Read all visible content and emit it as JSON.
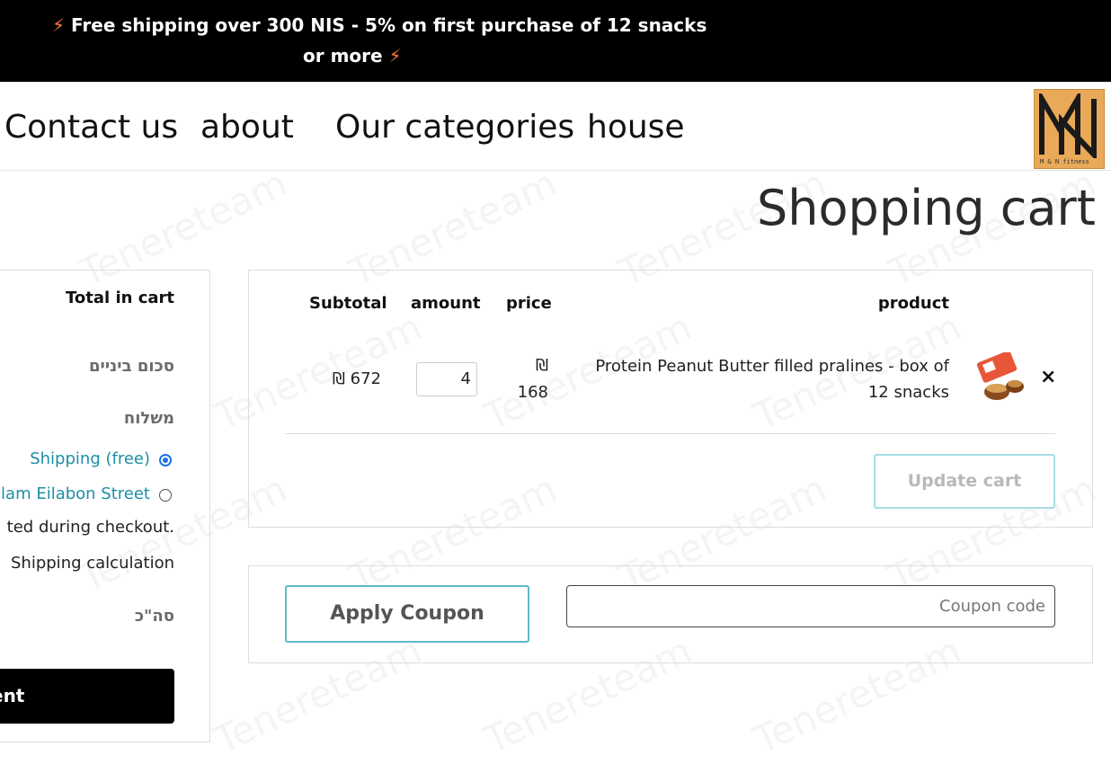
{
  "announcement": {
    "line1": "Free shipping over 300 NIS - 5% on first purchase of 12 snacks",
    "line2": "or more",
    "bolt_left": "⚡",
    "bolt_right": "⚡"
  },
  "nav": {
    "items": [
      "Contact us",
      "about",
      "Our categories",
      "house"
    ]
  },
  "logo": {
    "brand_text": "M & N fitness"
  },
  "page_title": "Shopping cart",
  "cart": {
    "headers": {
      "subtotal": "Subtotal",
      "amount": "amount",
      "price": "price",
      "product": "product"
    },
    "items": [
      {
        "product_line1": "Protein Peanut Butter filled pralines - box of",
        "product_line2": "12 snacks",
        "price_line1": "₪",
        "price_line2": "168",
        "quantity": "4",
        "subtotal": "₪ 672",
        "remove_glyph": "×"
      }
    ],
    "update_button": "Update cart"
  },
  "coupon": {
    "button": "Apply Coupon",
    "placeholder": "Coupon code"
  },
  "totals": {
    "heading": "Total in cart",
    "subtotal_label": "סכום ביניים",
    "shipping_label": "משלוח",
    "shipping_free": "Shipping (free)",
    "pickup_option": "lam Eilabon Street",
    "checkout_note": "ted during checkout.",
    "shipping_calc": "Shipping calculation",
    "total_label": "סה\"כ",
    "checkout_button": "ent"
  },
  "colors": {
    "announcement_bg": "#000000",
    "bolt": "#ff7a3d",
    "link_teal": "#1d8fa5",
    "button_border": "#5bbccb",
    "radio_on": "#1a73e8"
  }
}
